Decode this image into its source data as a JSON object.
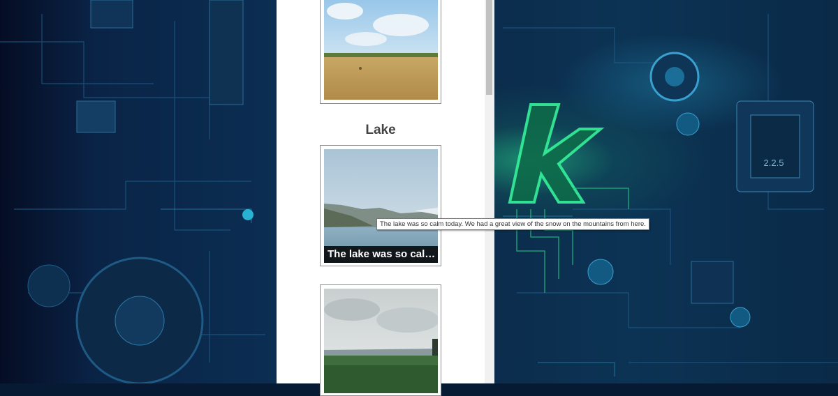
{
  "gallery": {
    "section_title": "Lake",
    "items": [
      {
        "name": "field",
        "caption": ""
      },
      {
        "name": "lake",
        "caption": "The lake was so cal…"
      },
      {
        "name": "meadow",
        "caption": ""
      }
    ]
  },
  "tooltip": {
    "text": "The lake was so calm today. We had a great view of the snow on the mountains from here."
  },
  "colors": {
    "background": "#0b2e52",
    "glow": "#29e08a",
    "page": "#ffffff"
  }
}
